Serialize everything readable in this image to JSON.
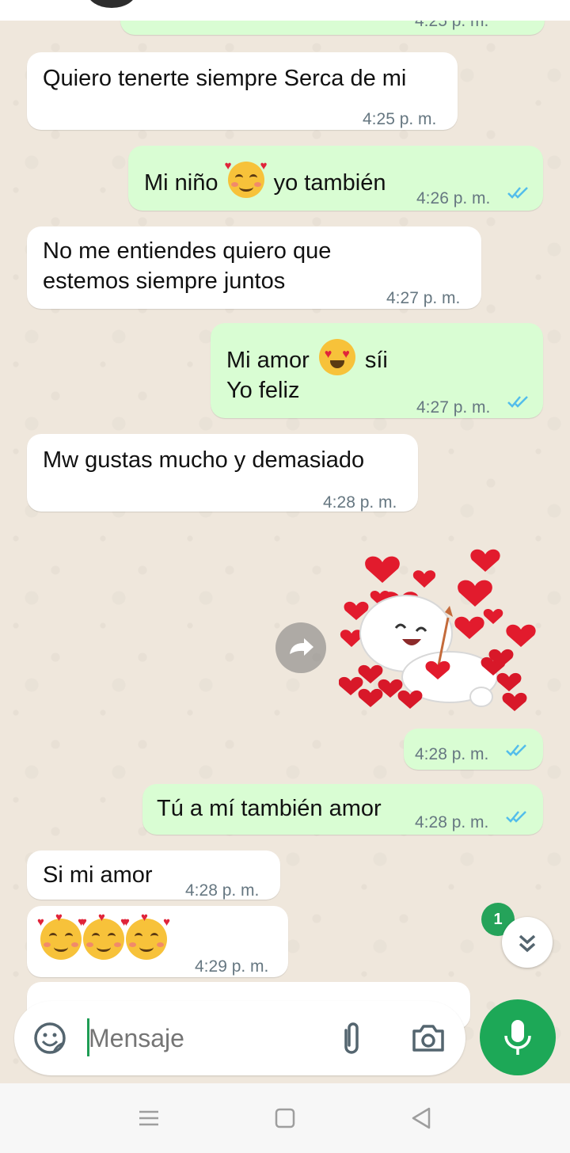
{
  "messages": [
    {
      "text": "Quiero tenerte siempre Serca de mi",
      "time": "4:25 p. m."
    },
    {
      "text_before": "Mi niño",
      "text_after": "yo también",
      "time": "4:26 p. m."
    },
    {
      "line1": "No me entiendes quiero que",
      "line2": "estemos siempre juntos",
      "time": "4:27 p. m."
    },
    {
      "line1_before": "Mi amor",
      "line1_after": "síi",
      "line2": "Yo feliz",
      "time": "4:27 p. m."
    },
    {
      "text": "Mw gustas mucho y demasiado",
      "time": "4:28 p. m."
    },
    {
      "sticker_time": "4:28 p. m."
    },
    {
      "text": "Tú a mí también amor",
      "time": "4:28 p. m."
    },
    {
      "text": "Si mi amor",
      "time": "4:28 p. m."
    },
    {
      "time": "4:29 p. m."
    }
  ],
  "top_partial_time": "4:25 p. m.",
  "unread_badge": "1",
  "input": {
    "placeholder": "Mensaje"
  },
  "colors": {
    "outgoing": "#d9fdd3",
    "incoming": "#ffffff",
    "accent": "#1da857",
    "read_ticks": "#53bdeb"
  },
  "icons": [
    "forward-icon",
    "sticker-icon",
    "attach-icon",
    "camera-icon",
    "mic-icon",
    "double-chevron-down-icon",
    "menu-icon",
    "home-icon",
    "back-icon"
  ]
}
